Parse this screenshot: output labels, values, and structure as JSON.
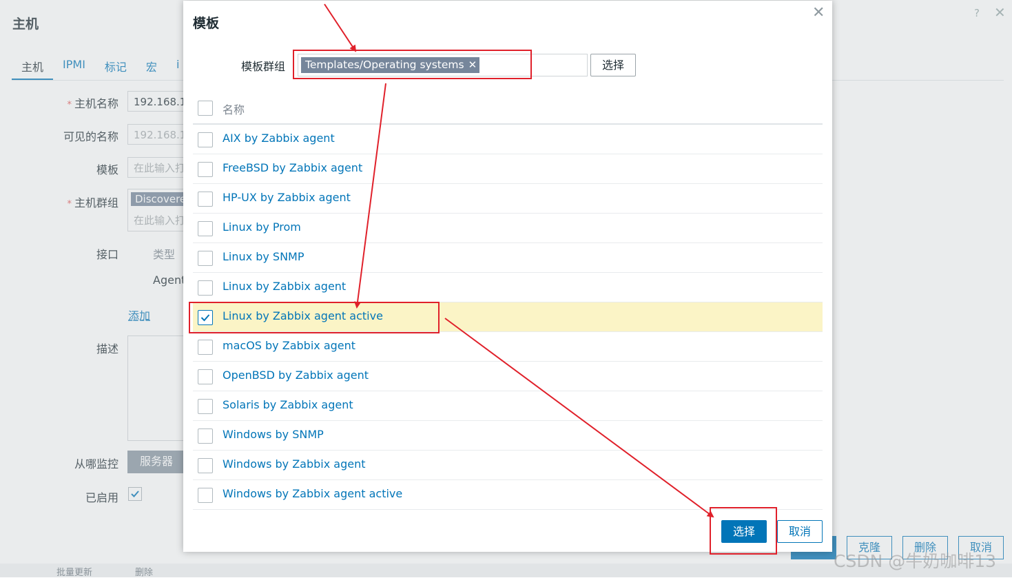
{
  "background_form": {
    "title": "主机",
    "help": "?",
    "close": "✕",
    "tabs": [
      {
        "label": "主机",
        "active": true
      },
      {
        "label": "IPMI"
      },
      {
        "label": "标记"
      },
      {
        "label": "宏"
      },
      {
        "label": "i"
      }
    ],
    "fields": {
      "host_name_label": "主机名称",
      "host_name_value": "192.168.1",
      "visible_name_label": "可见的名称",
      "visible_name_value": "192.168.1",
      "templates_label": "模板",
      "templates_placeholder": "在此输入打",
      "host_groups_label": "主机群组",
      "host_groups_chip": "Discovere",
      "host_groups_placeholder": "在此输入打",
      "interfaces_label": "接口",
      "interfaces_type_header": "类型",
      "interfaces_agent": "Agent",
      "add_link": "添加",
      "description_label": "描述",
      "monitored_by_label": "从哪监控",
      "monitored_by_value": "服务器",
      "enabled_label": "已启用",
      "enabled": true
    },
    "footer_buttons": [
      "克隆",
      "删除",
      "取消"
    ],
    "bottom_strip": [
      "批量更新",
      "删除"
    ]
  },
  "modal": {
    "title": "模板",
    "close": "✕",
    "group_label": "模板群组",
    "group_chip": "Templates/Operating systems",
    "chip_remove": "✕",
    "select_group_button": "选择",
    "table_header": "名称",
    "rows": [
      {
        "label": "AIX by Zabbix agent",
        "checked": false
      },
      {
        "label": "FreeBSD by Zabbix agent",
        "checked": false
      },
      {
        "label": "HP-UX by Zabbix agent",
        "checked": false
      },
      {
        "label": "Linux by Prom",
        "checked": false
      },
      {
        "label": "Linux by SNMP",
        "checked": false
      },
      {
        "label": "Linux by Zabbix agent",
        "checked": false
      },
      {
        "label": "Linux by Zabbix agent active",
        "checked": true
      },
      {
        "label": "macOS by Zabbix agent",
        "checked": false
      },
      {
        "label": "OpenBSD by Zabbix agent",
        "checked": false
      },
      {
        "label": "Solaris by Zabbix agent",
        "checked": false
      },
      {
        "label": "Windows by SNMP",
        "checked": false
      },
      {
        "label": "Windows by Zabbix agent",
        "checked": false
      },
      {
        "label": "Windows by Zabbix agent active",
        "checked": false
      }
    ],
    "select_button": "选择",
    "cancel_button": "取消"
  },
  "watermark": "CSDN @牛奶咖啡13",
  "colors": {
    "accent": "#0275b8",
    "selected_row": "#fbf4c6",
    "chip": "#76869b",
    "annotation": "#e0202a"
  }
}
